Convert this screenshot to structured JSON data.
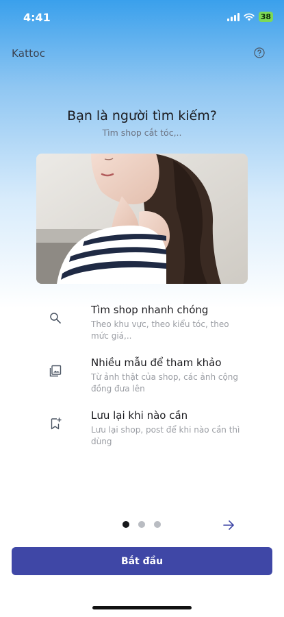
{
  "status_bar": {
    "time": "4:41",
    "battery": "38"
  },
  "header": {
    "brand": "Kattoc",
    "help_icon": "help-circle-icon"
  },
  "intro": {
    "title": "Bạn là người tìm kiếm?",
    "subtitle": "Tìm shop cắt tóc,.."
  },
  "features": [
    {
      "icon": "search-icon",
      "title": "Tìm shop nhanh chóng",
      "desc": "Theo khu vực, theo kiểu tóc, theo mức giá,.."
    },
    {
      "icon": "gallery-icon",
      "title": "Nhiều mẫu để tham khảo",
      "desc": "Từ ảnh thật của shop, các ảnh cộng đồng đưa lên"
    },
    {
      "icon": "bookmark-icon",
      "title": "Lưu lại khi nào cần",
      "desc": "Lưu lại shop, post để khi nào cần thì dùng"
    }
  ],
  "pager": {
    "current": 1,
    "total": 3
  },
  "cta": {
    "label": "Bắt đầu"
  },
  "colors": {
    "primary": "#3f47a6",
    "gradient_top": "#3aa0ec"
  }
}
